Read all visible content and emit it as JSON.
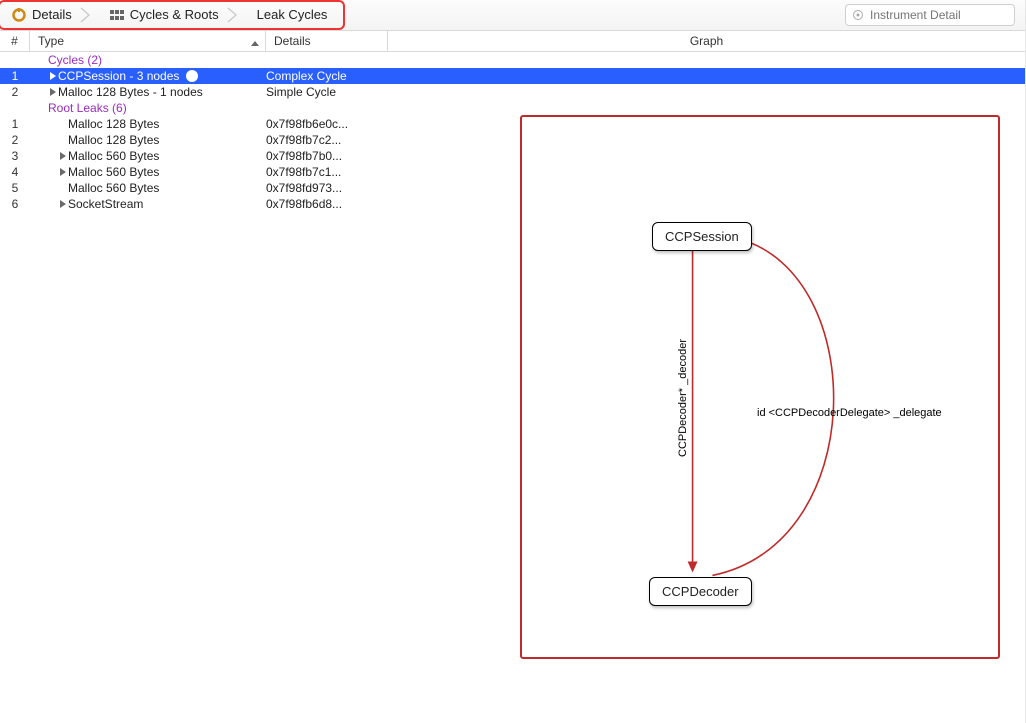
{
  "breadcrumb": {
    "items": [
      {
        "label": "Details"
      },
      {
        "label": "Cycles & Roots"
      },
      {
        "label": "Leak Cycles"
      }
    ]
  },
  "search": {
    "placeholder": "Instrument Detail"
  },
  "columns": {
    "num": "#",
    "type": "Type",
    "details": "Details",
    "graph": "Graph"
  },
  "list": {
    "section1": "Cycles (2)",
    "rows1": [
      {
        "num": "1",
        "type": "CCPSession - 3 nodes",
        "details": "Complex Cycle",
        "arrow": true,
        "expand": true,
        "selected": true
      },
      {
        "num": "2",
        "type": "Malloc 128 Bytes - 1 nodes",
        "details": "Simple Cycle",
        "arrow": false,
        "expand": true,
        "selected": false
      }
    ],
    "section2": "Root Leaks (6)",
    "rows2": [
      {
        "num": "1",
        "type": "Malloc 128 Bytes",
        "details": "0x7f98fb6e0c...",
        "expand": false
      },
      {
        "num": "2",
        "type": "Malloc 128 Bytes",
        "details": "0x7f98fb7c2...",
        "expand": false
      },
      {
        "num": "3",
        "type": "Malloc 560 Bytes",
        "details": "0x7f98fb7b0...",
        "expand": true
      },
      {
        "num": "4",
        "type": "Malloc 560 Bytes",
        "details": "0x7f98fb7c1...",
        "expand": true
      },
      {
        "num": "5",
        "type": "Malloc 560 Bytes",
        "details": "0x7f98fd973...",
        "expand": false
      },
      {
        "num": "6",
        "type": "SocketStream",
        "details": "0x7f98fb6d8...",
        "expand": true
      }
    ]
  },
  "graph": {
    "node_top": "CCPSession",
    "node_bot": "CCPDecoder",
    "edge_down": "CCPDecoder* _decoder",
    "edge_up": "id <CCPDecoderDelegate> _delegate"
  }
}
